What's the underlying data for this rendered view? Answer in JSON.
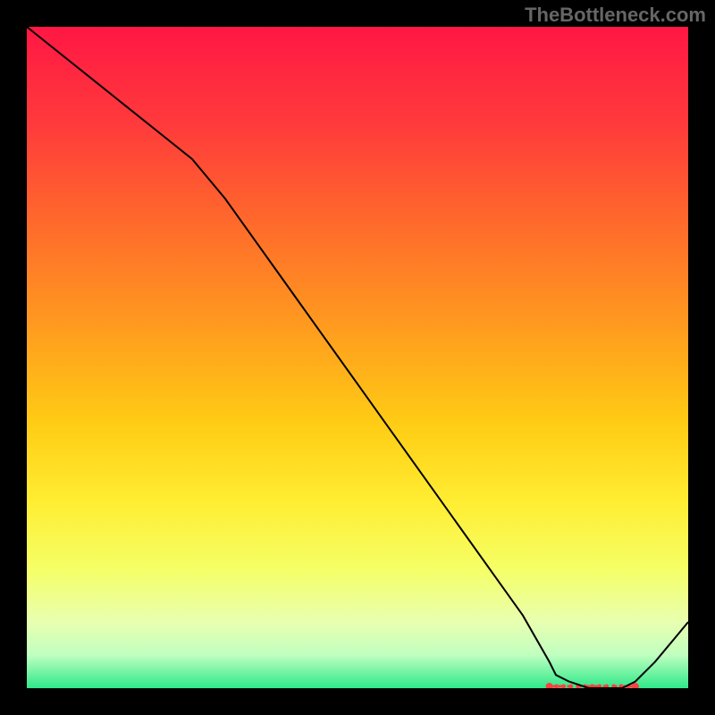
{
  "watermark": "TheBottleneck.com",
  "chart_data": {
    "type": "line",
    "x": [
      0,
      5,
      10,
      15,
      20,
      25,
      30,
      35,
      40,
      45,
      50,
      55,
      60,
      65,
      70,
      75,
      79,
      80,
      82,
      85,
      88,
      90,
      92,
      95,
      100
    ],
    "y": [
      100,
      96,
      92,
      88,
      84,
      80,
      74,
      67,
      60,
      53,
      46,
      39,
      32,
      25,
      18,
      11,
      4,
      2,
      1,
      0,
      0,
      0,
      1,
      4,
      10
    ],
    "xlim": [
      0,
      100
    ],
    "ylim": [
      0,
      100
    ],
    "title": "",
    "xlabel": "",
    "ylabel": "",
    "grid": false,
    "background_gradient": {
      "type": "vertical",
      "stops": [
        {
          "pos": 0.0,
          "color": "#ff1744"
        },
        {
          "pos": 0.15,
          "color": "#ff3b3b"
        },
        {
          "pos": 0.3,
          "color": "#ff6b2b"
        },
        {
          "pos": 0.45,
          "color": "#ff9a1f"
        },
        {
          "pos": 0.6,
          "color": "#ffcc14"
        },
        {
          "pos": 0.72,
          "color": "#ffee33"
        },
        {
          "pos": 0.82,
          "color": "#f5ff66"
        },
        {
          "pos": 0.9,
          "color": "#e8ffb0"
        },
        {
          "pos": 0.95,
          "color": "#c0ffc0"
        },
        {
          "pos": 1.0,
          "color": "#2ee88a"
        }
      ]
    },
    "annotations": [
      {
        "type": "highlight_segment",
        "x_start": 79,
        "x_end": 92,
        "y": 0,
        "color": "#ff4040",
        "style": "dotted-thick"
      }
    ],
    "line_color": "#000000",
    "line_width": 2
  }
}
